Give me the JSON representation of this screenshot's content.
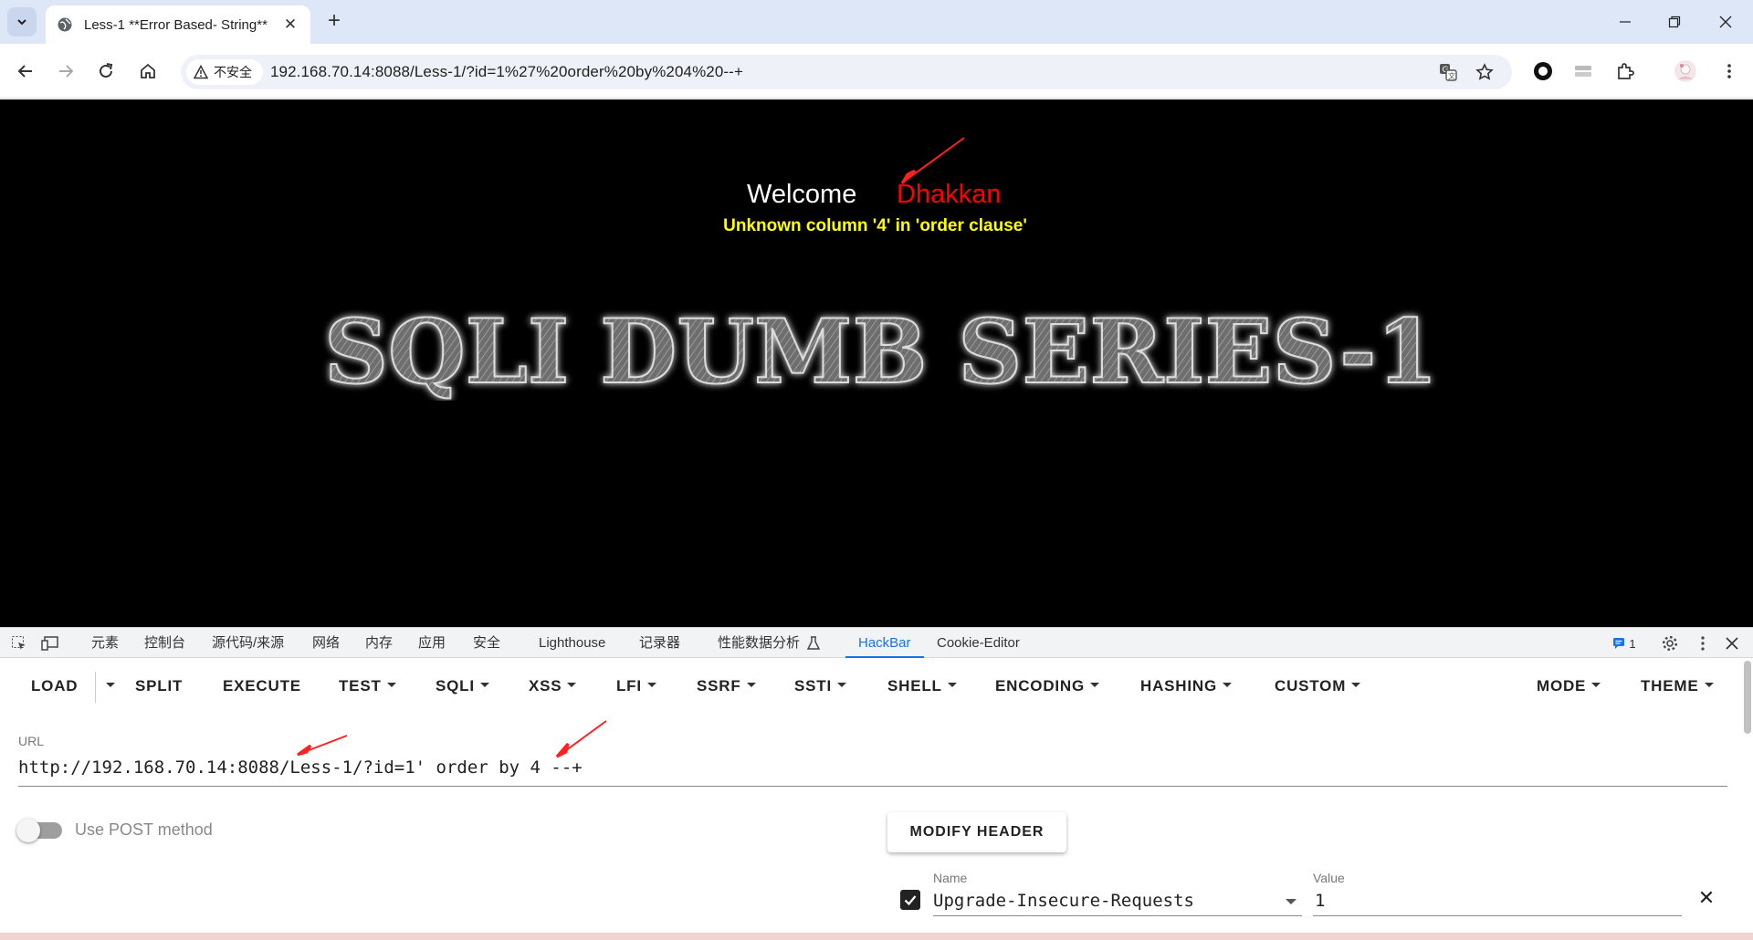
{
  "browser": {
    "tab_title": "Less-1 **Error Based- String**",
    "security_label": "不安全",
    "address": "192.168.70.14:8088/Less-1/?id=1%27%20order%20by%204%20--+"
  },
  "page": {
    "welcome": "Welcome",
    "name": "Dhakkan",
    "error": "Unknown column '4' in 'order clause'",
    "banner": "SQLI DUMB SERIES-1"
  },
  "devtools": {
    "tabs": [
      "元素",
      "控制台",
      "源代码/来源",
      "网络",
      "内存",
      "应用",
      "安全",
      "Lighthouse",
      "记录器",
      "性能数据分析",
      "HackBar",
      "Cookie-Editor"
    ],
    "issues_count": "1"
  },
  "hackbar": {
    "menu": {
      "load": "LOAD",
      "split": "SPLIT",
      "execute": "EXECUTE",
      "test": "TEST",
      "sqli": "SQLI",
      "xss": "XSS",
      "lfi": "LFI",
      "ssrf": "SSRF",
      "ssti": "SSTI",
      "shell": "SHELL",
      "encoding": "ENCODING",
      "hashing": "HASHING",
      "custom": "CUSTOM",
      "mode": "MODE",
      "theme": "THEME"
    },
    "url_label": "URL",
    "url_value": "http://192.168.70.14:8088/Less-1/?id=1' order by 4 --+",
    "post_label": "Use POST method",
    "modify_header": "MODIFY HEADER",
    "header_name_label": "Name",
    "header_name": "Upgrade-Insecure-Requests",
    "header_value_label": "Value",
    "header_value": "1"
  }
}
